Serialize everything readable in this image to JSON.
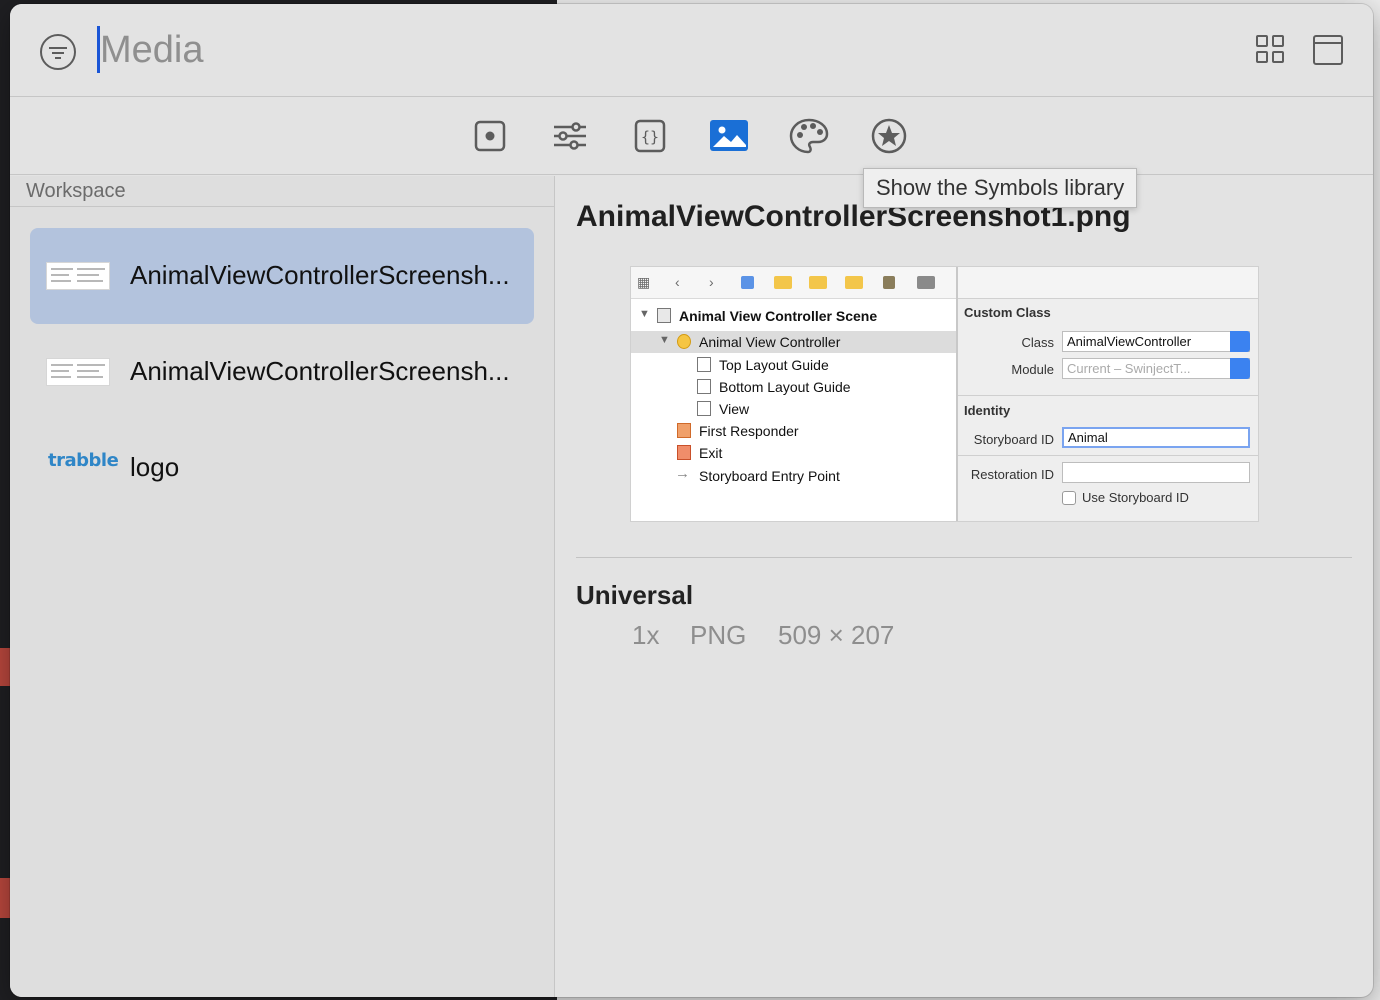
{
  "search": {
    "placeholder": "Media"
  },
  "tabs": [
    {
      "name": "views",
      "icon": "square-dot-icon"
    },
    {
      "name": "modifiers",
      "icon": "sliders-icon"
    },
    {
      "name": "snippets",
      "icon": "braces-icon"
    },
    {
      "name": "media",
      "icon": "photo-icon",
      "active": true
    },
    {
      "name": "colors",
      "icon": "palette-icon"
    },
    {
      "name": "symbols",
      "icon": "star-circle-icon"
    }
  ],
  "tooltip": {
    "text": "Show the Symbols library"
  },
  "sidebar": {
    "header": "Workspace",
    "items": [
      {
        "label": "AnimalViewControllerScreensh...",
        "selected": true
      },
      {
        "label": "AnimalViewControllerScreensh..."
      },
      {
        "label": "logo",
        "thumb_text": "trabble"
      }
    ]
  },
  "detail": {
    "title": "AnimalViewControllerScreenshot1.png",
    "section": "Universal",
    "scale": "1x",
    "format": "PNG",
    "dimensions": "509 × 207"
  },
  "preview": {
    "tree": [
      "Animal View Controller Scene",
      "Animal View Controller",
      "Top Layout Guide",
      "Bottom Layout Guide",
      "View",
      "First Responder",
      "Exit",
      "Storyboard Entry Point"
    ],
    "inspector": {
      "custom_class_header": "Custom Class",
      "class_label": "Class",
      "class_value": "AnimalViewController",
      "module_label": "Module",
      "module_value": "Current – SwinjectT...",
      "identity_header": "Identity",
      "storyboard_id_label": "Storyboard ID",
      "storyboard_id_value": "Animal",
      "restoration_id_label": "Restoration ID",
      "use_storyboard_id_label": "Use Storyboard ID"
    }
  },
  "colors": {
    "accent": "#1a55d6",
    "selection": "#b3c3dd",
    "active_tab": "#1a6fd6"
  }
}
